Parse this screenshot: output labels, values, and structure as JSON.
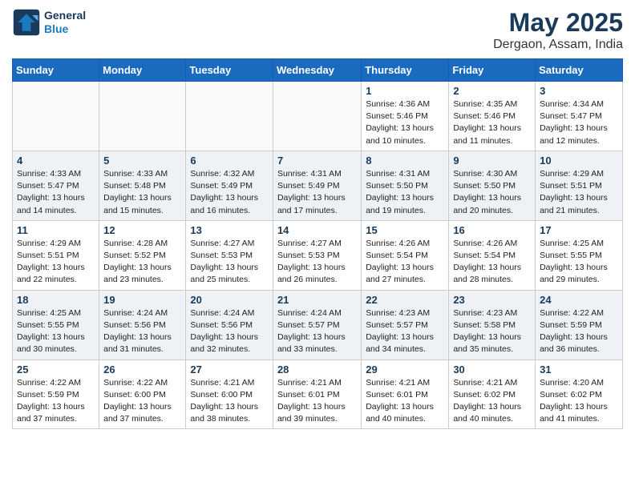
{
  "header": {
    "logo_line1": "General",
    "logo_line2": "Blue",
    "month": "May 2025",
    "location": "Dergaon, Assam, India"
  },
  "weekdays": [
    "Sunday",
    "Monday",
    "Tuesday",
    "Wednesday",
    "Thursday",
    "Friday",
    "Saturday"
  ],
  "weeks": [
    [
      {
        "day": "",
        "info": ""
      },
      {
        "day": "",
        "info": ""
      },
      {
        "day": "",
        "info": ""
      },
      {
        "day": "",
        "info": ""
      },
      {
        "day": "1",
        "info": "Sunrise: 4:36 AM\nSunset: 5:46 PM\nDaylight: 13 hours\nand 10 minutes."
      },
      {
        "day": "2",
        "info": "Sunrise: 4:35 AM\nSunset: 5:46 PM\nDaylight: 13 hours\nand 11 minutes."
      },
      {
        "day": "3",
        "info": "Sunrise: 4:34 AM\nSunset: 5:47 PM\nDaylight: 13 hours\nand 12 minutes."
      }
    ],
    [
      {
        "day": "4",
        "info": "Sunrise: 4:33 AM\nSunset: 5:47 PM\nDaylight: 13 hours\nand 14 minutes."
      },
      {
        "day": "5",
        "info": "Sunrise: 4:33 AM\nSunset: 5:48 PM\nDaylight: 13 hours\nand 15 minutes."
      },
      {
        "day": "6",
        "info": "Sunrise: 4:32 AM\nSunset: 5:49 PM\nDaylight: 13 hours\nand 16 minutes."
      },
      {
        "day": "7",
        "info": "Sunrise: 4:31 AM\nSunset: 5:49 PM\nDaylight: 13 hours\nand 17 minutes."
      },
      {
        "day": "8",
        "info": "Sunrise: 4:31 AM\nSunset: 5:50 PM\nDaylight: 13 hours\nand 19 minutes."
      },
      {
        "day": "9",
        "info": "Sunrise: 4:30 AM\nSunset: 5:50 PM\nDaylight: 13 hours\nand 20 minutes."
      },
      {
        "day": "10",
        "info": "Sunrise: 4:29 AM\nSunset: 5:51 PM\nDaylight: 13 hours\nand 21 minutes."
      }
    ],
    [
      {
        "day": "11",
        "info": "Sunrise: 4:29 AM\nSunset: 5:51 PM\nDaylight: 13 hours\nand 22 minutes."
      },
      {
        "day": "12",
        "info": "Sunrise: 4:28 AM\nSunset: 5:52 PM\nDaylight: 13 hours\nand 23 minutes."
      },
      {
        "day": "13",
        "info": "Sunrise: 4:27 AM\nSunset: 5:53 PM\nDaylight: 13 hours\nand 25 minutes."
      },
      {
        "day": "14",
        "info": "Sunrise: 4:27 AM\nSunset: 5:53 PM\nDaylight: 13 hours\nand 26 minutes."
      },
      {
        "day": "15",
        "info": "Sunrise: 4:26 AM\nSunset: 5:54 PM\nDaylight: 13 hours\nand 27 minutes."
      },
      {
        "day": "16",
        "info": "Sunrise: 4:26 AM\nSunset: 5:54 PM\nDaylight: 13 hours\nand 28 minutes."
      },
      {
        "day": "17",
        "info": "Sunrise: 4:25 AM\nSunset: 5:55 PM\nDaylight: 13 hours\nand 29 minutes."
      }
    ],
    [
      {
        "day": "18",
        "info": "Sunrise: 4:25 AM\nSunset: 5:55 PM\nDaylight: 13 hours\nand 30 minutes."
      },
      {
        "day": "19",
        "info": "Sunrise: 4:24 AM\nSunset: 5:56 PM\nDaylight: 13 hours\nand 31 minutes."
      },
      {
        "day": "20",
        "info": "Sunrise: 4:24 AM\nSunset: 5:56 PM\nDaylight: 13 hours\nand 32 minutes."
      },
      {
        "day": "21",
        "info": "Sunrise: 4:24 AM\nSunset: 5:57 PM\nDaylight: 13 hours\nand 33 minutes."
      },
      {
        "day": "22",
        "info": "Sunrise: 4:23 AM\nSunset: 5:57 PM\nDaylight: 13 hours\nand 34 minutes."
      },
      {
        "day": "23",
        "info": "Sunrise: 4:23 AM\nSunset: 5:58 PM\nDaylight: 13 hours\nand 35 minutes."
      },
      {
        "day": "24",
        "info": "Sunrise: 4:22 AM\nSunset: 5:59 PM\nDaylight: 13 hours\nand 36 minutes."
      }
    ],
    [
      {
        "day": "25",
        "info": "Sunrise: 4:22 AM\nSunset: 5:59 PM\nDaylight: 13 hours\nand 37 minutes."
      },
      {
        "day": "26",
        "info": "Sunrise: 4:22 AM\nSunset: 6:00 PM\nDaylight: 13 hours\nand 37 minutes."
      },
      {
        "day": "27",
        "info": "Sunrise: 4:21 AM\nSunset: 6:00 PM\nDaylight: 13 hours\nand 38 minutes."
      },
      {
        "day": "28",
        "info": "Sunrise: 4:21 AM\nSunset: 6:01 PM\nDaylight: 13 hours\nand 39 minutes."
      },
      {
        "day": "29",
        "info": "Sunrise: 4:21 AM\nSunset: 6:01 PM\nDaylight: 13 hours\nand 40 minutes."
      },
      {
        "day": "30",
        "info": "Sunrise: 4:21 AM\nSunset: 6:02 PM\nDaylight: 13 hours\nand 40 minutes."
      },
      {
        "day": "31",
        "info": "Sunrise: 4:20 AM\nSunset: 6:02 PM\nDaylight: 13 hours\nand 41 minutes."
      }
    ]
  ]
}
